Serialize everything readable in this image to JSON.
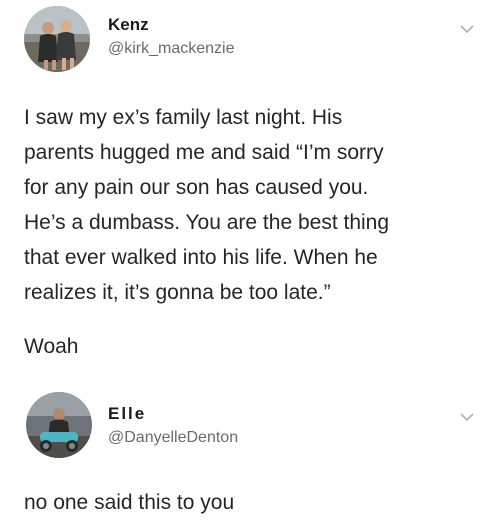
{
  "tweets": [
    {
      "name": "Kenz",
      "handle": "@kirk_mackenzie",
      "text_lines": [
        "I saw my ex’s family last night. His",
        "parents hugged me and said “I’m sorry",
        "for any pain our son has caused you.",
        "He’s a dumbass. You are the best thing",
        "that ever walked into his life. When he",
        "realizes it, it’s gonna be too late.”"
      ],
      "extra_line": "Woah",
      "menu_icon": "chevron-down-icon",
      "avatar_icon": "profile-photo"
    },
    {
      "name": "Elle",
      "handle": "@DanyelleDenton",
      "text_lines": [
        "no one said this to you"
      ],
      "menu_icon": "chevron-down-icon",
      "avatar_icon": "profile-photo"
    }
  ],
  "colors": {
    "background": "#ffffff",
    "name": "#1a1a1a",
    "handle": "#6b6b6b",
    "text": "#262626",
    "chevron": "#b0b0b0"
  }
}
